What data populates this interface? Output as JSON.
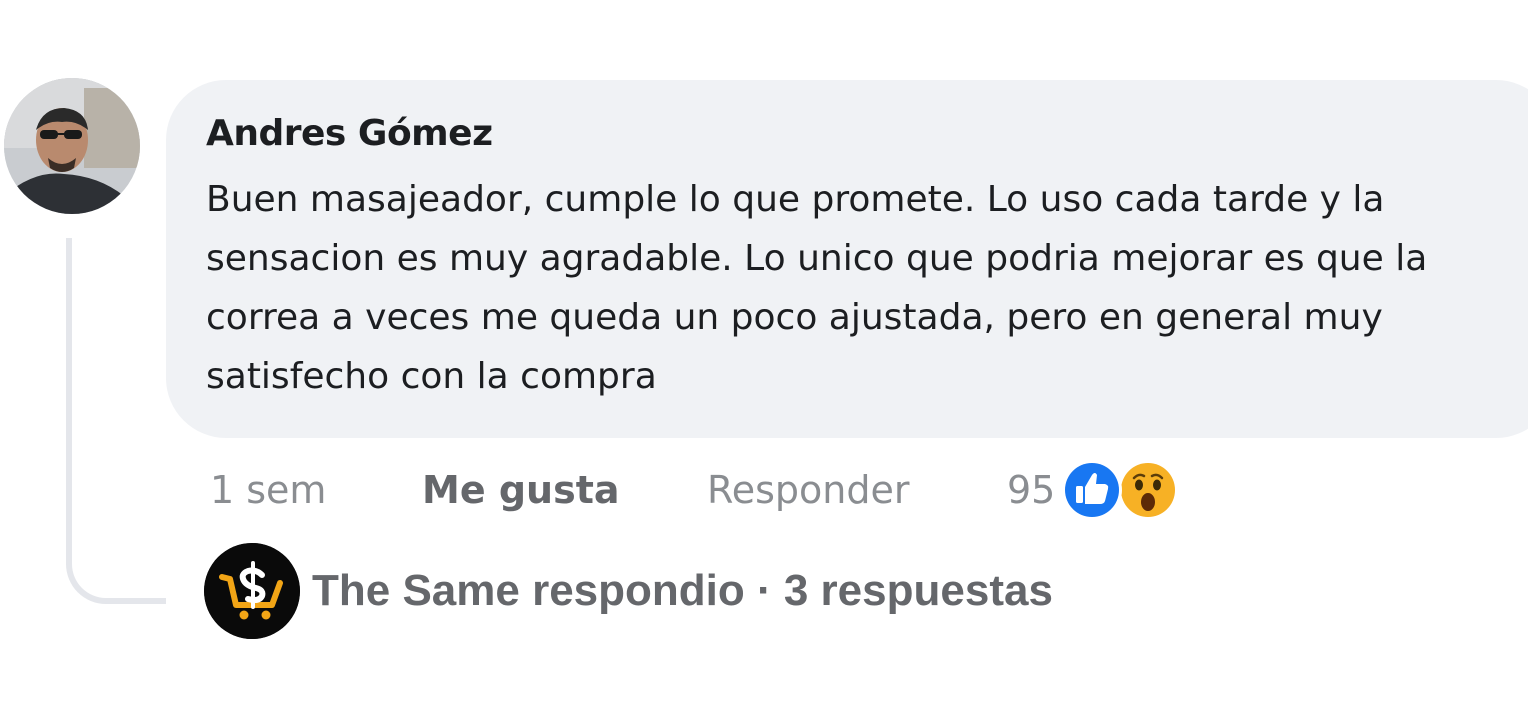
{
  "comment": {
    "author": "Andres Gómez",
    "text": "Buen masajeador, cumple lo que promete. Lo uso cada tarde y la sensacion es muy agradable. Lo unico que podria mejorar es que la correa a veces me queda un poco ajustada, pero en general muy satisfecho con la compra",
    "avatar_icon": "person-photo"
  },
  "actions": {
    "timestamp": "1 sem",
    "like_label": "Me gusta",
    "reply_label": "Responder",
    "reaction_count": "95",
    "reactions": [
      "like-icon",
      "wow-icon"
    ]
  },
  "replies": {
    "logo_icon": "the-same-logo",
    "label": "The Same respondio · 3 respuestas"
  },
  "colors": {
    "bubble": "#f0f2f5",
    "text": "#1c1e21",
    "secondary": "#65676b",
    "like_blue": "#1877f2",
    "wow_yellow": "#f7b125"
  }
}
